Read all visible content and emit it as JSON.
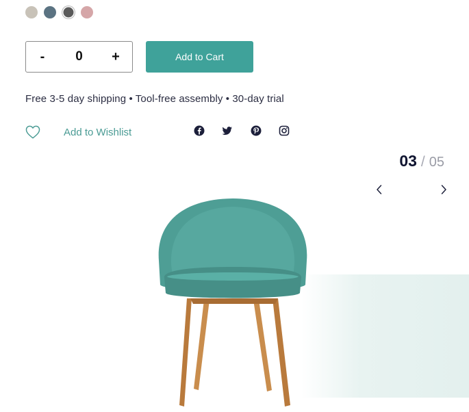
{
  "swatches": [
    {
      "color": "#c8c2b8",
      "selected": false
    },
    {
      "color": "#5b7382",
      "selected": false
    },
    {
      "color": "#5a5a5a",
      "selected": true
    },
    {
      "color": "#d5a6a8",
      "selected": false
    }
  ],
  "quantity": {
    "minus": "-",
    "value": "0",
    "plus": "+"
  },
  "cart": {
    "label": "Add to Cart"
  },
  "shipping_text": "Free 3-5 day shipping • Tool-free assembly • 30-day trial",
  "wishlist": {
    "label": "Add to Wishlist"
  },
  "social": [
    "facebook-icon",
    "twitter-icon",
    "pinterest-icon",
    "instagram-icon"
  ],
  "slider": {
    "current": "03",
    "separator": "/",
    "total": "05"
  },
  "colors": {
    "accent": "#3fa29a",
    "accent_text": "#4a9b94",
    "chair": "#4e9e95",
    "wood": "#c98d4d"
  }
}
